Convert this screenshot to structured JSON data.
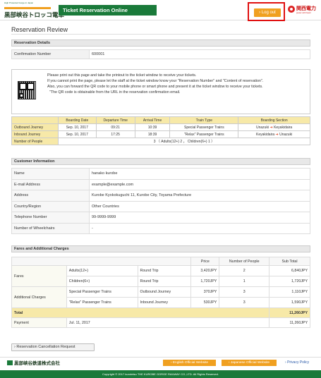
{
  "header": {
    "logo_tagline": "High Protected Gorge in Japan",
    "logo_name": "黒部峡谷トロッコ電車",
    "ticket_title": "Ticket Reservation Online",
    "logout_label": "Log out",
    "partner_name": "関西電力",
    "partner_sub": "power with heart"
  },
  "page_title": "Reservation Review",
  "reservation_details": {
    "heading": "Reservation Details",
    "confirmation_label": "Confirmation Number",
    "confirmation_value": "600001"
  },
  "instructions": [
    "Please print out this page and take the printout to the ticket window to receive your tickets.",
    "If you cannot print the page, please let the staff at the ticket window know your \"Reservation Number\" and \"Content of reservation\".",
    "Also, you can forward the QR code to your mobile phone or smart phone and present it at the ticket window to receive your tickets.",
    "\"The QR code is obtainable from the URL in the reservation confirmation email."
  ],
  "journey": {
    "columns": [
      "",
      "Boarding Date",
      "Departure Time",
      "Arrival Time",
      "Train Type",
      "Boarding Section"
    ],
    "rows": [
      {
        "label": "Outbound Journey",
        "date": "Sep. 10, 2017",
        "dep": "09:21",
        "arr": "10:39",
        "type": "Special Passenger Trains",
        "from": "Unazuki",
        "to": "Keyakidaira"
      },
      {
        "label": "Inbound Journey",
        "date": "Sep. 10, 2017",
        "dep": "17:25",
        "arr": "18:39",
        "type": "\"Relax\" Passenger Trains",
        "from": "Keyakidaira",
        "to": "Unazuki"
      }
    ],
    "people_label": "Number of People",
    "people_value": "3 （ Adults(12+) 2 ， Children(6+) 1 ）"
  },
  "customer": {
    "heading": "Customer Information",
    "rows": [
      {
        "label": "Name",
        "value": "hanako kurobe"
      },
      {
        "label": "E-mail Address",
        "value": "example@example.com"
      },
      {
        "label": "Address",
        "value": "Kurobe Kyokokuguchi 11, Kurobe City, Toyama Prefecture"
      },
      {
        "label": "Country/Region",
        "value": "Other Countries"
      },
      {
        "label": "Telephone Number",
        "value": "99-9999-9999"
      },
      {
        "label": "Number of Wheelchairs",
        "value": "-"
      }
    ]
  },
  "fares": {
    "heading": "Fares and Additional Charges",
    "col_price": "Price",
    "col_people": "Number of People",
    "col_subtotal": "Sub Total",
    "fares_label": "Fares",
    "fare_rows": [
      {
        "item": "Adults(12+)",
        "trip": "Round Trip",
        "price": "3,420JPY",
        "people": "2",
        "subtotal": "6,840JPY"
      },
      {
        "item": "Children(6+)",
        "trip": "Round Trip",
        "price": "1,720JPY",
        "people": "1",
        "subtotal": "1,720JPY"
      }
    ],
    "additional_label": "Additional Charges",
    "additional_rows": [
      {
        "item": "Special Passenger Trains",
        "trip": "Outbound Journey",
        "price": "370JPY",
        "people": "3",
        "subtotal": "1,110JPY"
      },
      {
        "item": "\"Relax\" Passenger Trains",
        "trip": "Inbound Journey",
        "price": "530JPY",
        "people": "3",
        "subtotal": "1,590JPY"
      }
    ],
    "total_label": "Total",
    "total_value": "11,260JPY",
    "payment_label": "Payment",
    "payment_date": "Jul. 11, 2017",
    "payment_value": "11,260JPY"
  },
  "cancel_label": "Reservation Cancellation Request",
  "footer": {
    "company": "黒部峡谷鉄道株式会社",
    "english_site": "English Official Website",
    "japanese_site": "Japanese Official Website",
    "privacy": "Privacy Policy",
    "copyright": "Copyright © 2017 kurotetsu THE KUROBE GORGE RAILWAY CO.,LTD. All Rights Reserved."
  },
  "colors": {
    "brand_green": "#1a7a3a",
    "accent_orange": "#f0a020",
    "highlight_yellow": "#f7e9a8",
    "logout_outline": "#e01010"
  }
}
